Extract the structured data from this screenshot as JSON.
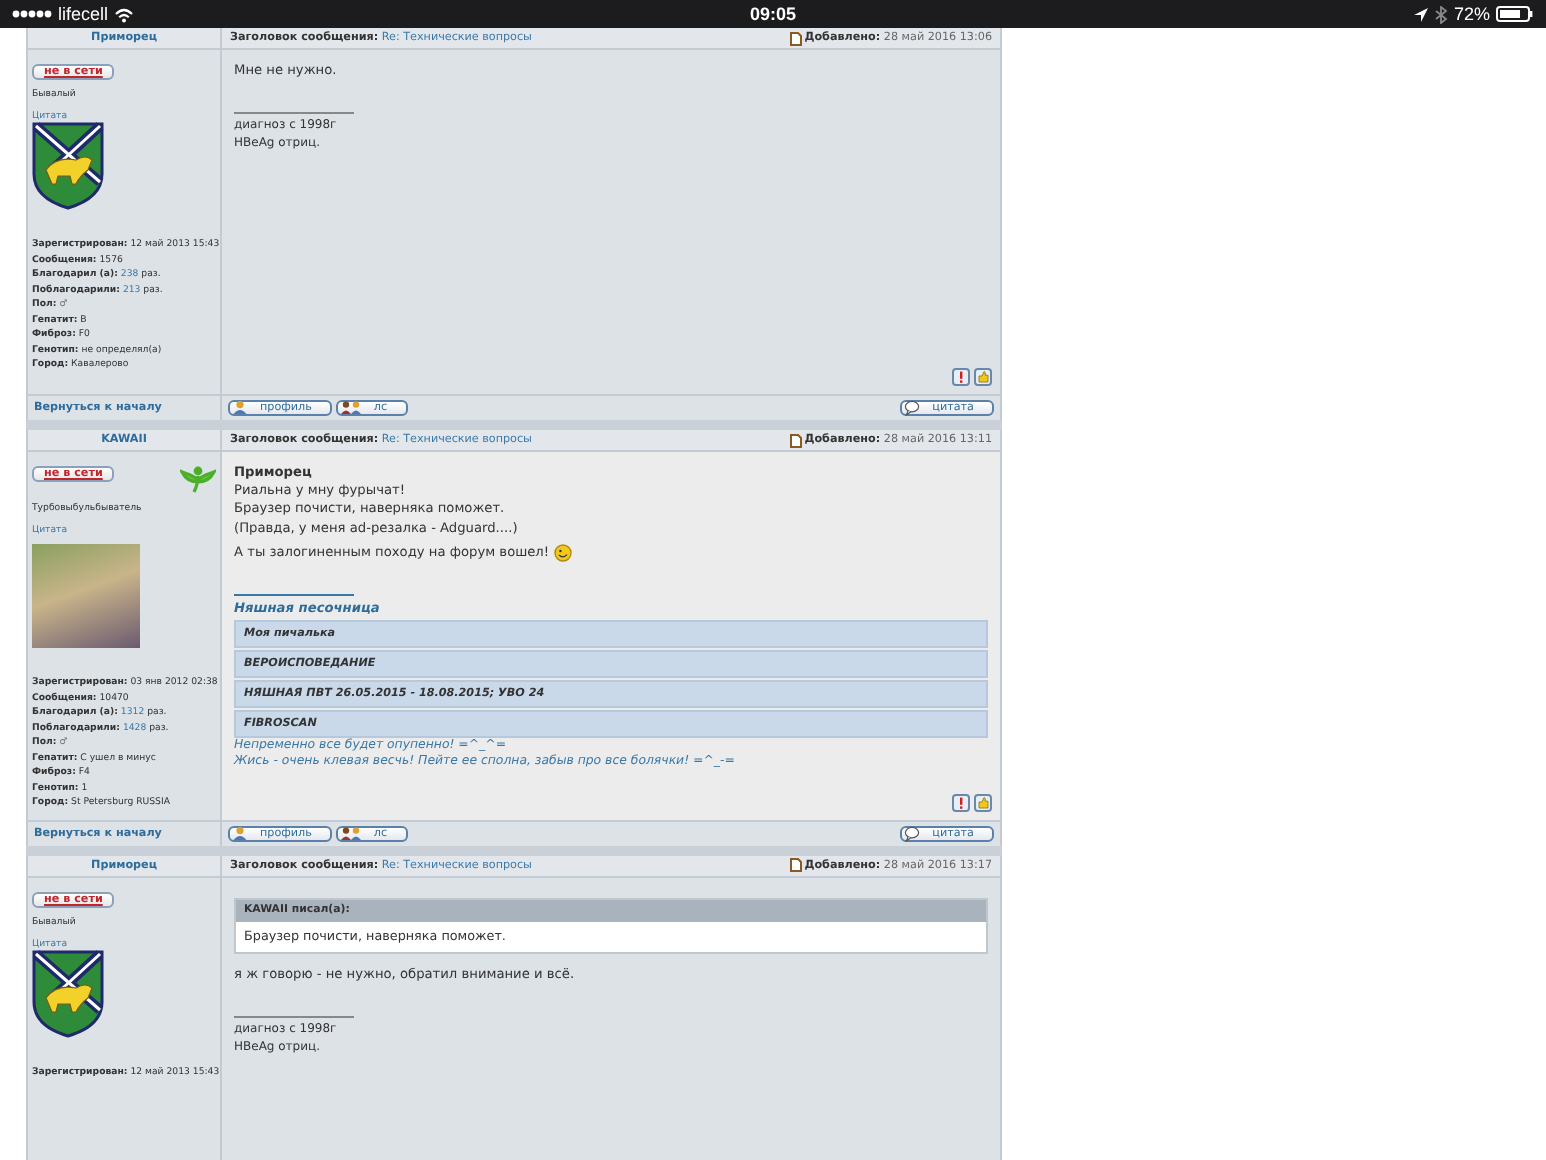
{
  "status_bar": {
    "carrier": "lifecell",
    "time": "09:05",
    "battery": "72%"
  },
  "posts": [
    {
      "author": "Приморец",
      "status": "не в сети",
      "rank": "Бывалый",
      "quote_link": "Цитата",
      "avatar": {
        "kind": "crest"
      },
      "badge": false,
      "report_icons": true,
      "profile": [
        {
          "kind": "plain",
          "label": "Зарегистрирован:",
          "value": "12 май 2013 15:43"
        },
        {
          "kind": "plain",
          "label": "Сообщения:",
          "value": "1576"
        },
        {
          "kind": "count",
          "label": "Благодарил (а):",
          "value": "238",
          "unit": "раз."
        },
        {
          "kind": "count",
          "label": "Поблагодарили:",
          "value": "213",
          "unit": "раз."
        },
        {
          "kind": "gender",
          "label": "Пол:",
          "value": "♂"
        },
        {
          "kind": "plain",
          "label": "Гепатит:",
          "value": "B"
        },
        {
          "kind": "plain",
          "label": "Фиброз:",
          "value": "F0"
        },
        {
          "kind": "plain",
          "label": "Генотип:",
          "value": "не определял(а)"
        },
        {
          "kind": "plain",
          "label": "Город:",
          "value": "Кавалерово"
        }
      ],
      "subject_label": "Заголовок сообщения:",
      "subject": "Re: Технические вопросы",
      "added_label": "Добавлено:",
      "added": "28 май 2016 13:06",
      "body": [
        {
          "kind": "text",
          "text": "Мне не нужно.",
          "smiley": false
        },
        {
          "kind": "signature",
          "lines": [
            "диагноз с 1998г",
            "HBeAg отриц."
          ]
        }
      ],
      "footer": {
        "back_link": "Вернуться к началу",
        "buttons": [
          {
            "kind": "profile",
            "label": "профиль"
          },
          {
            "kind": "pm",
            "label": "лс"
          },
          {
            "kind": "quote",
            "label": "цитата"
          }
        ]
      }
    },
    {
      "author": "KAWAII",
      "status": "не в сети",
      "rank": "Турбовыбульбыватель",
      "quote_link": "Цитата",
      "avatar": {
        "kind": "picture"
      },
      "badge": true,
      "report_icons": true,
      "profile": [
        {
          "kind": "plain",
          "label": "Зарегистрирован:",
          "value": "03 янв 2012 02:38"
        },
        {
          "kind": "plain",
          "label": "Сообщения:",
          "value": "10470"
        },
        {
          "kind": "count",
          "label": "Благодарил (а):",
          "value": "1312",
          "unit": "раз."
        },
        {
          "kind": "count",
          "label": "Поблагодарили:",
          "value": "1428",
          "unit": "раз."
        },
        {
          "kind": "gender",
          "label": "Пол:",
          "value": "♂"
        },
        {
          "kind": "plain",
          "label": "Гепатит:",
          "value": "С ушел в минус"
        },
        {
          "kind": "plain",
          "label": "Фиброз:",
          "value": "F4"
        },
        {
          "kind": "plain",
          "label": "Генотип:",
          "value": "1"
        },
        {
          "kind": "plain",
          "label": "Город:",
          "value": "St Petersburg RUSSIA"
        }
      ],
      "subject_label": "Заголовок сообщения:",
      "subject": "Re: Технические вопросы",
      "added_label": "Добавлено:",
      "added": "28 май 2016 13:11",
      "body": [
        {
          "kind": "name",
          "text": "Приморец"
        },
        {
          "kind": "lines",
          "lines": [
            "Риальна у мну фурычат!",
            "Браузер почисти, наверняка поможет.",
            "(Правда, у меня ad-резалка - Adguard....)"
          ]
        },
        {
          "kind": "text",
          "text": "А ты залогиненным походу на форум вошел!",
          "smiley": true
        },
        {
          "kind": "sig_table",
          "title": "Няшная песочница",
          "rows": [
            "Моя пичалька",
            "ВЕРОИСПОВЕДАНИЕ",
            "НЯШНАЯ ПВТ 26.05.2015 - 18.08.2015; УВО 24",
            "FIBROSCAN"
          ],
          "notes": [
            "Непременно все будет опупенно! =^_^=",
            "Жись - очень клевая весчь! Пейте ее сполна, забыв про все болячки! =^_-="
          ]
        }
      ],
      "footer": {
        "back_link": "Вернуться к началу",
        "buttons": [
          {
            "kind": "profile",
            "label": "профиль"
          },
          {
            "kind": "pm",
            "label": "лс"
          },
          {
            "kind": "quote",
            "label": "цитата"
          }
        ]
      }
    },
    {
      "author": "Приморец",
      "status": "не в сети",
      "rank": "Бывалый",
      "quote_link": "Цитата",
      "avatar": {
        "kind": "crest"
      },
      "badge": false,
      "report_icons": false,
      "profile": [
        {
          "kind": "plain",
          "label": "Зарегистрирован:",
          "value": "12 май 2013 15:43"
        }
      ],
      "subject_label": "Заголовок сообщения:",
      "subject": "Re: Технические вопросы",
      "added_label": "Добавлено:",
      "added": "28 май 2016 13:17",
      "body": [
        {
          "kind": "quote",
          "author": "KAWAII писал(а):",
          "text": "Браузер почисти, наверняка поможет."
        },
        {
          "kind": "text",
          "text": "я ж говорю - не нужно, обратил внимание и всё.",
          "smiley": false
        },
        {
          "kind": "signature",
          "lines": [
            "диагноз с 1998г",
            "HBeAg отриц."
          ]
        }
      ]
    }
  ]
}
